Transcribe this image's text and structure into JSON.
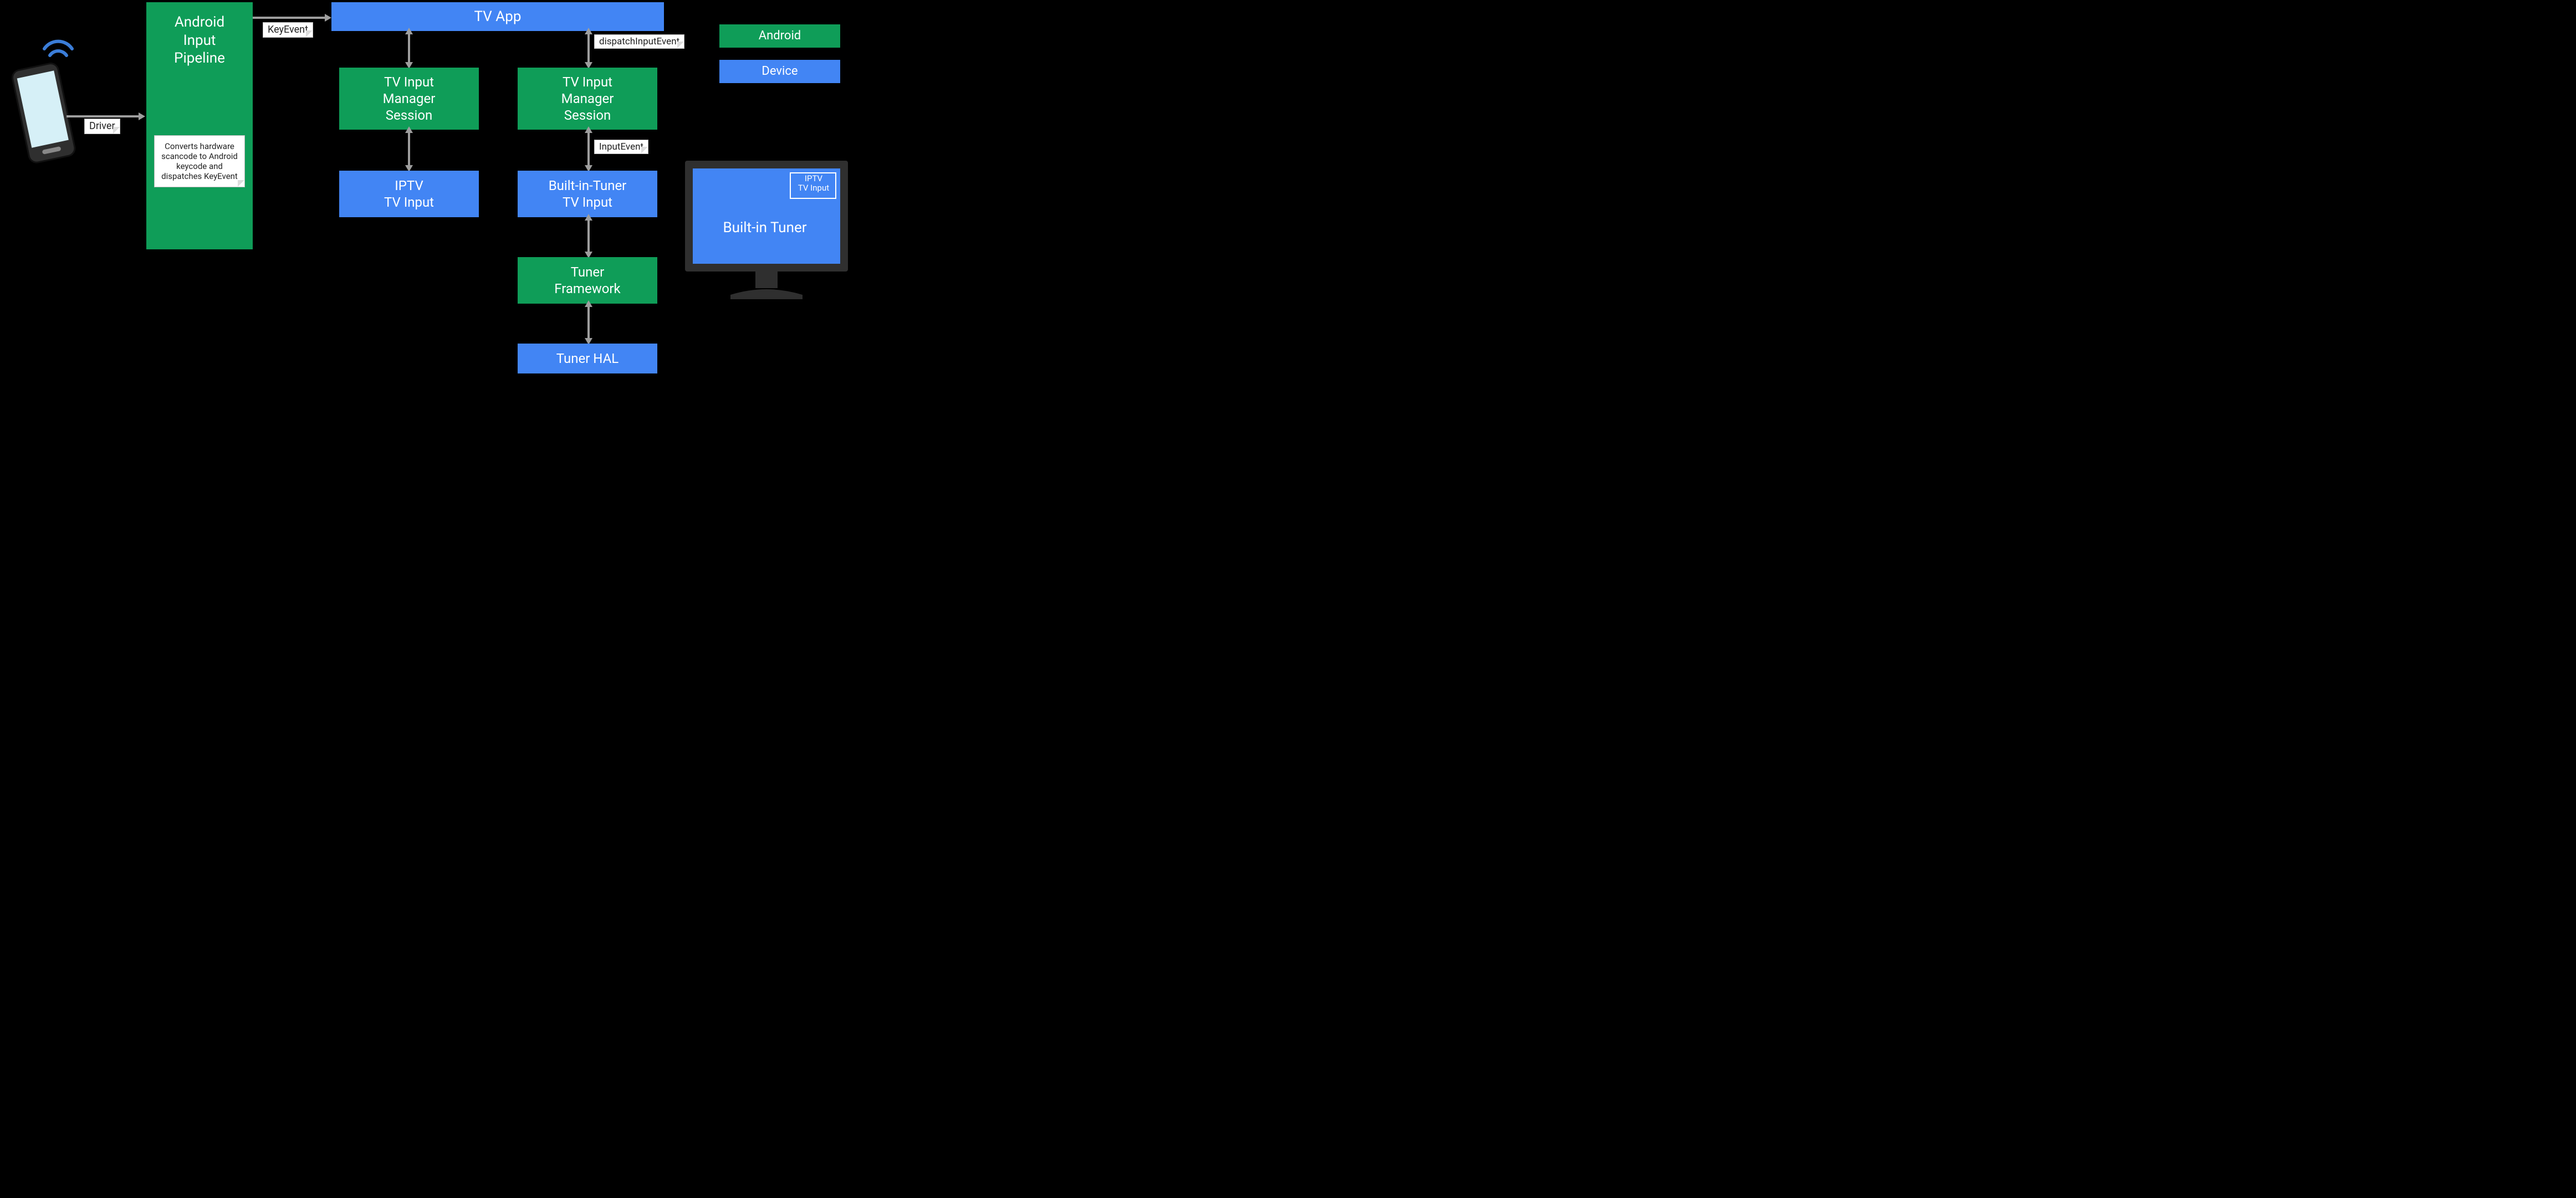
{
  "colors": {
    "android": "#0f9d58",
    "device": "#4285f4"
  },
  "legend": {
    "android": "Android",
    "device": "Device"
  },
  "phone_edge_label": "Driver",
  "pipeline": {
    "title": "Android\nInput\nPipeline",
    "note": "Converts hardware scancode to Android keycode and dispatches KeyEvent"
  },
  "edges": {
    "pipeline_to_tvapp": "KeyEvent",
    "tvapp_to_right_session": "dispatchInputEvent",
    "right_session_to_builtin": "InputEvent"
  },
  "nodes": {
    "tv_app": "TV App",
    "left_session": "TV Input\nManager\nSession",
    "right_session": "TV Input\nManager\nSession",
    "iptv_input": "IPTV\nTV Input",
    "builtin_input": "Built-in-Tuner\nTV Input",
    "tuner_framework": "Tuner\nFramework",
    "tuner_hal": "Tuner HAL"
  },
  "monitor": {
    "main_label": "Built-in Tuner",
    "badge": "IPTV\nTV Input"
  }
}
